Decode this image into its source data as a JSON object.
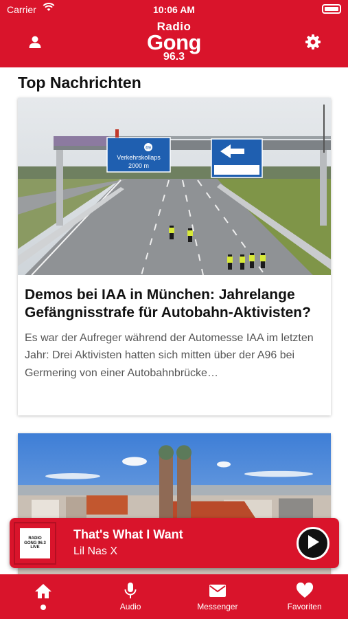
{
  "status_bar": {
    "carrier": "Carrier",
    "time": "10:06 AM"
  },
  "header": {
    "logo_line1": "Radio",
    "logo_line2": "Gong",
    "logo_line3": "96.3",
    "left_icon": "user-icon",
    "right_icon": "gear-icon",
    "brand_color": "#d9142b"
  },
  "section": {
    "title": "Top Nachrichten"
  },
  "articles": [
    {
      "title": "Demos bei IAA in München: Jahrelange Gefängnisstrafe für Autobahn-Aktivisten?",
      "teaser": "Es war der Aufreger während der Automesse IAA im letzten Jahr: Drei Aktivisten hatten sich mitten über der A96 bei Germering von einer Autobahnbrücke…",
      "image": {
        "description_icon": "highway-photo",
        "sign_left_line1": "Verkehrskollaps",
        "sign_left_line2": "2000 m",
        "sign_left_number": "69"
      }
    },
    {
      "title": "",
      "teaser": "",
      "image": {
        "description_icon": "munich-frauenkirche-photo"
      }
    }
  ],
  "player": {
    "cover_line1": "RADIO",
    "cover_line2": "GONG 96.3",
    "cover_line3": "LIVE",
    "track_title": "That's What I Want",
    "track_artist": "Lil Nas X",
    "play_icon": "play-icon"
  },
  "tabs": [
    {
      "label": "",
      "icon": "home-icon",
      "active": true
    },
    {
      "label": "Audio",
      "icon": "microphone-icon",
      "active": false
    },
    {
      "label": "Messenger",
      "icon": "envelope-icon",
      "active": false
    },
    {
      "label": "Favoriten",
      "icon": "heart-icon",
      "active": false
    }
  ]
}
